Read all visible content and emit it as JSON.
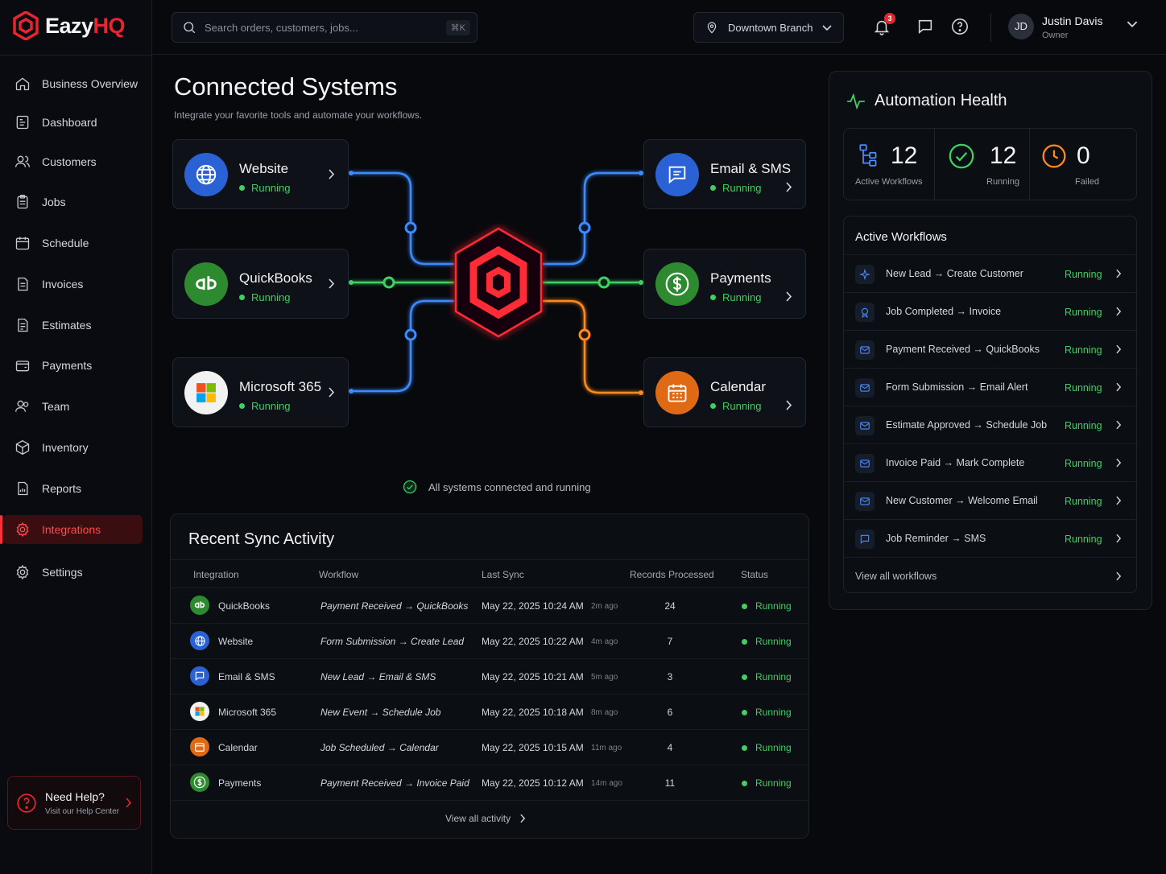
{
  "brand": {
    "name_part1": "Eazy",
    "name_part2": "HQ",
    "accent": "#e8252f"
  },
  "search": {
    "placeholder": "Search orders, customers, jobs...",
    "shortcut": "⌘K"
  },
  "branch": {
    "label": "Downtown Branch"
  },
  "notifications": {
    "count": "3"
  },
  "user": {
    "initials": "JD",
    "name": "Justin Davis",
    "role": "Owner"
  },
  "sidebar": {
    "items": [
      {
        "label": "Business Overview",
        "icon": "home-icon"
      },
      {
        "label": "Dashboard",
        "icon": "dashboard-icon"
      },
      {
        "label": "Customers",
        "icon": "users-icon"
      },
      {
        "label": "Jobs",
        "icon": "clipboard-icon"
      },
      {
        "label": "Schedule",
        "icon": "calendar-icon"
      },
      {
        "label": "Invoices",
        "icon": "invoice-icon"
      },
      {
        "label": "Estimates",
        "icon": "estimate-icon"
      },
      {
        "label": "Payments",
        "icon": "wallet-icon"
      },
      {
        "label": "Team",
        "icon": "team-icon"
      },
      {
        "label": "Inventory",
        "icon": "box-icon"
      },
      {
        "label": "Reports",
        "icon": "report-icon"
      },
      {
        "label": "Integrations",
        "icon": "gear-icon",
        "active": true
      },
      {
        "label": "Settings",
        "icon": "settings-icon"
      }
    ],
    "help": {
      "title": "Need Help?",
      "subtitle": "Visit our Help Center"
    }
  },
  "page": {
    "title": "Connected Systems",
    "subtitle": "Integrate your favorite tools and automate your workflows."
  },
  "systems": {
    "website": {
      "name": "Website",
      "status": "Running"
    },
    "quickbooks": {
      "name": "QuickBooks",
      "status": "Running"
    },
    "microsoft": {
      "name": "Microsoft 365",
      "status": "Running"
    },
    "email": {
      "name": "Email & SMS",
      "status": "Running"
    },
    "payments": {
      "name": "Payments",
      "status": "Running"
    },
    "calendar": {
      "name": "Calendar",
      "status": "Running"
    },
    "summary": "All systems connected and running"
  },
  "sync": {
    "title": "Recent Sync Activity",
    "headers": {
      "integration": "Integration",
      "workflow": "Workflow",
      "last_sync": "Last Sync",
      "records": "Records Processed",
      "status": "Status"
    },
    "rows": [
      {
        "integration": "QuickBooks",
        "workflow": "Payment Received → QuickBooks",
        "date": "May 22, 2025 10:24 AM",
        "ago": "2m ago",
        "records": "24",
        "status": "Running"
      },
      {
        "integration": "Website",
        "workflow": "Form Submission → Create Lead",
        "date": "May 22, 2025 10:22 AM",
        "ago": "4m ago",
        "records": "7",
        "status": "Running"
      },
      {
        "integration": "Email & SMS",
        "workflow": "New Lead → Email & SMS",
        "date": "May 22, 2025 10:21 AM",
        "ago": "5m ago",
        "records": "3",
        "status": "Running"
      },
      {
        "integration": "Microsoft 365",
        "workflow": "New Event → Schedule Job",
        "date": "May 22, 2025 10:18 AM",
        "ago": "8m ago",
        "records": "6",
        "status": "Running"
      },
      {
        "integration": "Calendar",
        "workflow": "Job Scheduled → Calendar",
        "date": "May 22, 2025 10:15 AM",
        "ago": "11m ago",
        "records": "4",
        "status": "Running"
      },
      {
        "integration": "Payments",
        "workflow": "Payment Received → Invoice Paid",
        "date": "May 22, 2025 10:12 AM",
        "ago": "14m ago",
        "records": "11",
        "status": "Running"
      }
    ],
    "view_all": "View all activity"
  },
  "health": {
    "title": "Automation Health",
    "stats": {
      "active": {
        "value": "12",
        "label": "Active Workflows"
      },
      "running": {
        "value": "12",
        "label": "Running"
      },
      "failed": {
        "value": "0",
        "label": "Failed"
      }
    },
    "workflows_title": "Active Workflows",
    "workflows": [
      {
        "name": "New Lead → Create Customer",
        "status": "Running"
      },
      {
        "name": "Job Completed → Invoice",
        "status": "Running"
      },
      {
        "name": "Payment Received → QuickBooks",
        "status": "Running"
      },
      {
        "name": "Form Submission → Email Alert",
        "status": "Running"
      },
      {
        "name": "Estimate Approved → Schedule Job",
        "status": "Running"
      },
      {
        "name": "Invoice Paid → Mark Complete",
        "status": "Running"
      },
      {
        "name": "New Customer → Welcome Email",
        "status": "Running"
      },
      {
        "name": "Job Reminder → SMS",
        "status": "Running"
      }
    ],
    "view_all": "View all workflows"
  }
}
